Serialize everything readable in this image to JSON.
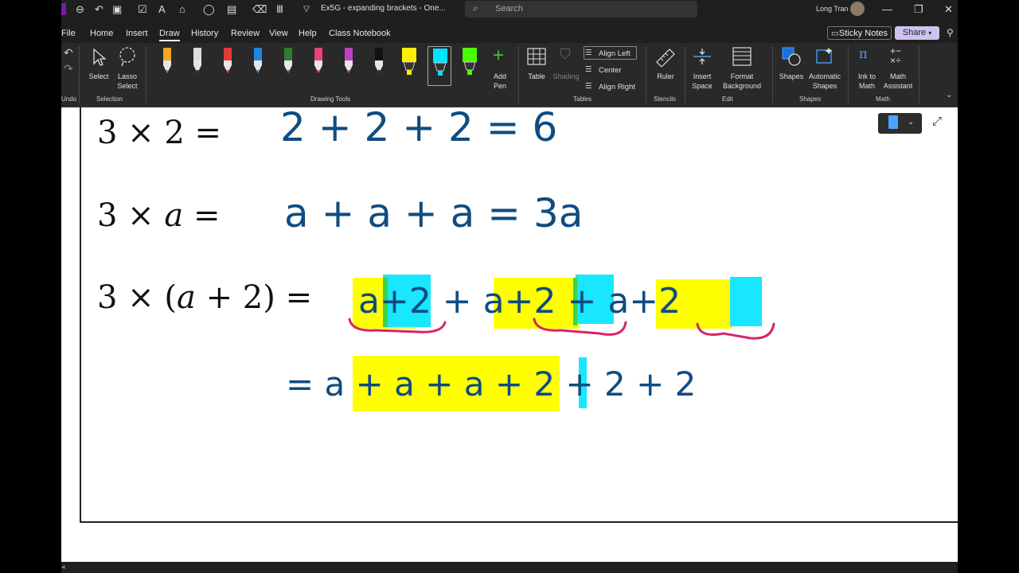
{
  "window": {
    "title": "Ex5G - expanding brackets  -  One...",
    "user_name": "Long Tran",
    "search_placeholder": "Search"
  },
  "menu": {
    "items": [
      "File",
      "Home",
      "Insert",
      "Draw",
      "History",
      "Review",
      "View",
      "Help",
      "Class Notebook"
    ],
    "active": "Draw",
    "sticky_notes_label": "Sticky Notes",
    "share_label": "Share"
  },
  "ribbon": {
    "undo_group": "Undo",
    "selection": {
      "select": "Select",
      "lasso_line1": "Lasso",
      "lasso_line2": "Select",
      "group": "Selection"
    },
    "drawing_tools": {
      "group": "Drawing Tools",
      "add_pen_line1": "Add",
      "add_pen_line2": "Pen",
      "pens": [
        {
          "name": "pencil-orange",
          "color": "#f5a623",
          "tip": "#9b59b6"
        },
        {
          "name": "pencil-white",
          "color": "#dddddd",
          "tip": "#222222"
        },
        {
          "name": "pen-red",
          "color": "#e53935",
          "tip": "#e53935"
        },
        {
          "name": "pen-blue",
          "color": "#1e88e5",
          "tip": "#1e88e5"
        },
        {
          "name": "pen-green",
          "color": "#2e7d32",
          "tip": "#2e7d32"
        },
        {
          "name": "pen-pink",
          "color": "#ec407a",
          "tip": "#ec407a"
        },
        {
          "name": "pen-magenta",
          "color": "#c040c0",
          "tip": "#c040c0"
        },
        {
          "name": "pen-black",
          "color": "#111111",
          "tip": "#111111"
        },
        {
          "name": "highlighter-yellow",
          "color": "#ffee00",
          "tip": "#ffee00"
        },
        {
          "name": "highlighter-cyan",
          "color": "#00e5ff",
          "tip": "#00e5ff"
        },
        {
          "name": "highlighter-green",
          "color": "#4cff00",
          "tip": "#4cff00"
        }
      ]
    },
    "tables": {
      "table": "Table",
      "shading": "Shading",
      "align_left": "Align Left",
      "center": "Center",
      "align_right": "Align Right",
      "group": "Tables"
    },
    "stencils": {
      "ruler": "Ruler",
      "group": "Stencils"
    },
    "edit": {
      "insert_line1": "Insert",
      "insert_line2": "Space",
      "format_line1": "Format",
      "format_line2": "Background",
      "group": "Edit"
    },
    "shapes": {
      "shapes": "Shapes",
      "auto_line1": "Automatic",
      "auto_line2": "Shapes",
      "group": "Shapes"
    },
    "math": {
      "ink_line1": "Ink to",
      "ink_line2": "Math",
      "math_line1": "Math",
      "math_line2": "Assistant",
      "group": "Math"
    }
  },
  "canvas": {
    "typed_lines": [
      "3 × 2 =",
      "3 × 𝑎 =",
      "3 × (𝑎 + 2) ="
    ],
    "ink_lines": [
      "2 + 2 + 2 = 6",
      "a + a + a = 3a",
      "a+2 + a+2 + a+2",
      "= a + a + a + 2 + 2 + 2"
    ],
    "colors": {
      "ink_blue": "#0f4c81",
      "ink_green": "#0d7a2e",
      "highlight_yellow": "#ffff00",
      "highlight_cyan": "#19e6ff",
      "underline_pink": "#d6246e"
    }
  }
}
